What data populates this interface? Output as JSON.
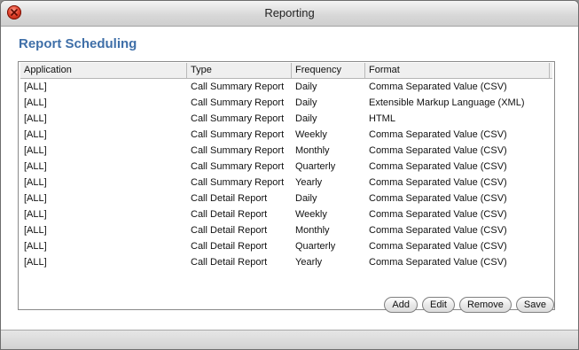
{
  "window": {
    "title": "Reporting"
  },
  "page": {
    "title": "Report Scheduling"
  },
  "table": {
    "columns": [
      "Application",
      "Type",
      "Frequency",
      "Format"
    ],
    "rows": [
      [
        "[ALL]",
        "Call Summary Report",
        "Daily",
        "Comma Separated Value (CSV)"
      ],
      [
        "[ALL]",
        "Call Summary Report",
        "Daily",
        "Extensible Markup Language (XML)"
      ],
      [
        "[ALL]",
        "Call Summary Report",
        "Daily",
        "HTML"
      ],
      [
        "[ALL]",
        "Call Summary Report",
        "Weekly",
        "Comma Separated Value (CSV)"
      ],
      [
        "[ALL]",
        "Call Summary Report",
        "Monthly",
        "Comma Separated Value (CSV)"
      ],
      [
        "[ALL]",
        "Call Summary Report",
        "Quarterly",
        "Comma Separated Value (CSV)"
      ],
      [
        "[ALL]",
        "Call Summary Report",
        "Yearly",
        "Comma Separated Value (CSV)"
      ],
      [
        "[ALL]",
        "Call Detail Report",
        "Daily",
        "Comma Separated Value (CSV)"
      ],
      [
        "[ALL]",
        "Call Detail Report",
        "Weekly",
        "Comma Separated Value (CSV)"
      ],
      [
        "[ALL]",
        "Call Detail Report",
        "Monthly",
        "Comma Separated Value (CSV)"
      ],
      [
        "[ALL]",
        "Call Detail Report",
        "Quarterly",
        "Comma Separated Value (CSV)"
      ],
      [
        "[ALL]",
        "Call Detail Report",
        "Yearly",
        "Comma Separated Value (CSV)"
      ]
    ]
  },
  "buttons": {
    "add": "Add",
    "edit": "Edit",
    "remove": "Remove",
    "save": "Save"
  },
  "icons": {
    "close": "close-icon"
  },
  "colors": {
    "title": "#3f6fa8",
    "close": "#e0402a"
  }
}
